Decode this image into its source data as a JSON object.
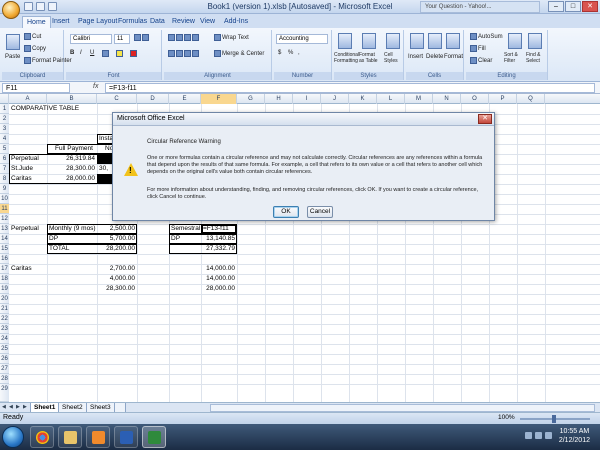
{
  "window": {
    "title": "Book1 (version 1).xlsb [Autosaved] - Microsoft Excel",
    "other_tab": "Your Question - Yahoo!...",
    "minimize": "–",
    "maximize": "□",
    "close": "✕"
  },
  "ribbon_tabs": [
    "Home",
    "Insert",
    "Page Layout",
    "Formulas",
    "Data",
    "Review",
    "View",
    "Add-Ins"
  ],
  "ribbon": {
    "clipboard": {
      "paste": "Paste",
      "cut": "Cut",
      "copy": "Copy",
      "format_painter": "Format Painter",
      "label": "Clipboard"
    },
    "font": {
      "name": "Calibri",
      "size": "11",
      "bold": "B",
      "italic": "I",
      "underline": "U",
      "label": "Font"
    },
    "alignment": {
      "wrap": "Wrap Text",
      "merge": "Merge & Center",
      "label": "Alignment"
    },
    "number": {
      "format": "Accounting",
      "currency": "$",
      "percent": "%",
      "comma": ",",
      "label": "Number"
    },
    "styles": {
      "conditional": "Conditional Formatting",
      "format_table": "Format as Table",
      "cell_styles": "Cell Styles",
      "label": "Styles"
    },
    "cells": {
      "insert": "Insert",
      "delete": "Delete",
      "format": "Format",
      "label": "Cells"
    },
    "editing": {
      "autosum": "AutoSum",
      "fill": "Fill",
      "clear": "Clear",
      "sort": "Sort & Filter",
      "find": "Find & Select",
      "label": "Editing"
    }
  },
  "formula_bar": {
    "name_box": "F11",
    "fx": "fx",
    "formula": "=F13-f11"
  },
  "columns": [
    "A",
    "B",
    "C",
    "D",
    "E",
    "F",
    "G",
    "H",
    "I",
    "J",
    "K",
    "L",
    "M",
    "N",
    "O",
    "P",
    "Q"
  ],
  "rows": [
    "1",
    "2",
    "3",
    "4",
    "5",
    "6",
    "7",
    "8",
    "9",
    "10",
    "11",
    "12",
    "13",
    "14",
    "15",
    "16",
    "17",
    "18",
    "19",
    "20",
    "21",
    "22",
    "23",
    "24",
    "25",
    "26",
    "27",
    "28",
    "29"
  ],
  "cells": {
    "a1": "COMPARATIVE TABLE",
    "c3": "Instal",
    "b4": "Full Payment",
    "c4": "No D",
    "a5": "Perpetual",
    "b5": "26,319.84",
    "a6": "St.Jude",
    "b6": "28,300.00",
    "c6": "30,",
    "a7": "Caritas",
    "b7": "28,000.00",
    "a11": "Perpetual",
    "b11": "Monthly (9 mos)",
    "c11": "2,500.00",
    "e11": "Semestral",
    "f11": "=F13-f11",
    "b12": "DP",
    "c12": "5,700.00",
    "e12": "DP",
    "f12": "13,140.85",
    "b13": "TOTAL",
    "c13": "28,200.00",
    "f13": "27,332.79",
    "a15": "Caritas",
    "c15": "2,700.00",
    "f15": "14,000.00",
    "c16": "4,000.00",
    "f16": "14,000.00",
    "c17": "28,300.00",
    "f17": "28,000.00"
  },
  "sheets": [
    "Sheet1",
    "Sheet2",
    "Sheet3"
  ],
  "status": {
    "ready": "Ready",
    "zoom": "100%"
  },
  "dialog": {
    "title": "Microsoft Office Excel",
    "heading": "Circular Reference Warning",
    "body": "One or more formulas contain a circular reference and may not calculate correctly. Circular references are any references within a formula that depend upon the results of that same formula. For example, a cell that refers to its own value or a cell that refers to another cell which depends on the original cell's value both contain circular references.",
    "body2": "For more information about understanding, finding, and removing circular references, click OK. If you want to create a circular reference, click Cancel to continue.",
    "ok": "OK",
    "cancel": "Cancel",
    "icon": "warning-icon"
  },
  "taskbar": {
    "time": "10:55 AM",
    "date": "2/12/2012"
  }
}
